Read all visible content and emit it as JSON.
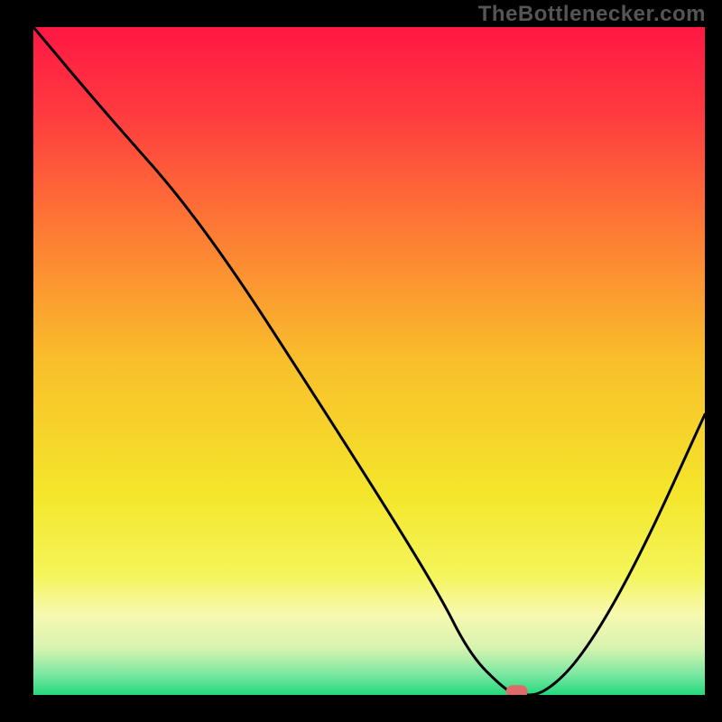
{
  "watermark": "TheBottlenecker.com",
  "chart_data": {
    "type": "line",
    "title": "",
    "xlabel": "",
    "ylabel": "",
    "xlim": [
      0,
      100
    ],
    "ylim": [
      0,
      100
    ],
    "background": {
      "type": "vertical_gradient",
      "stops": [
        {
          "pos": 0.0,
          "color": "#ff1744"
        },
        {
          "pos": 0.13,
          "color": "#ff3b3f"
        },
        {
          "pos": 0.3,
          "color": "#fd7935"
        },
        {
          "pos": 0.5,
          "color": "#f9bf2b"
        },
        {
          "pos": 0.7,
          "color": "#f4e62b"
        },
        {
          "pos": 0.82,
          "color": "#f4f55a"
        },
        {
          "pos": 0.88,
          "color": "#f7f9b0"
        },
        {
          "pos": 0.93,
          "color": "#d7f3b0"
        },
        {
          "pos": 0.97,
          "color": "#78e7a1"
        },
        {
          "pos": 1.0,
          "color": "#23d97b"
        }
      ]
    },
    "series": [
      {
        "name": "curve",
        "x": [
          0,
          10,
          25,
          45,
          60,
          65,
          70,
          72,
          76,
          82,
          90,
          100
        ],
        "y": [
          100,
          88,
          71,
          40,
          16,
          6,
          1,
          0,
          0,
          6,
          20,
          42
        ]
      }
    ],
    "marker": {
      "x": 72,
      "y": 0.5,
      "color": "#e06a6a",
      "shape": "rounded_rect"
    }
  }
}
